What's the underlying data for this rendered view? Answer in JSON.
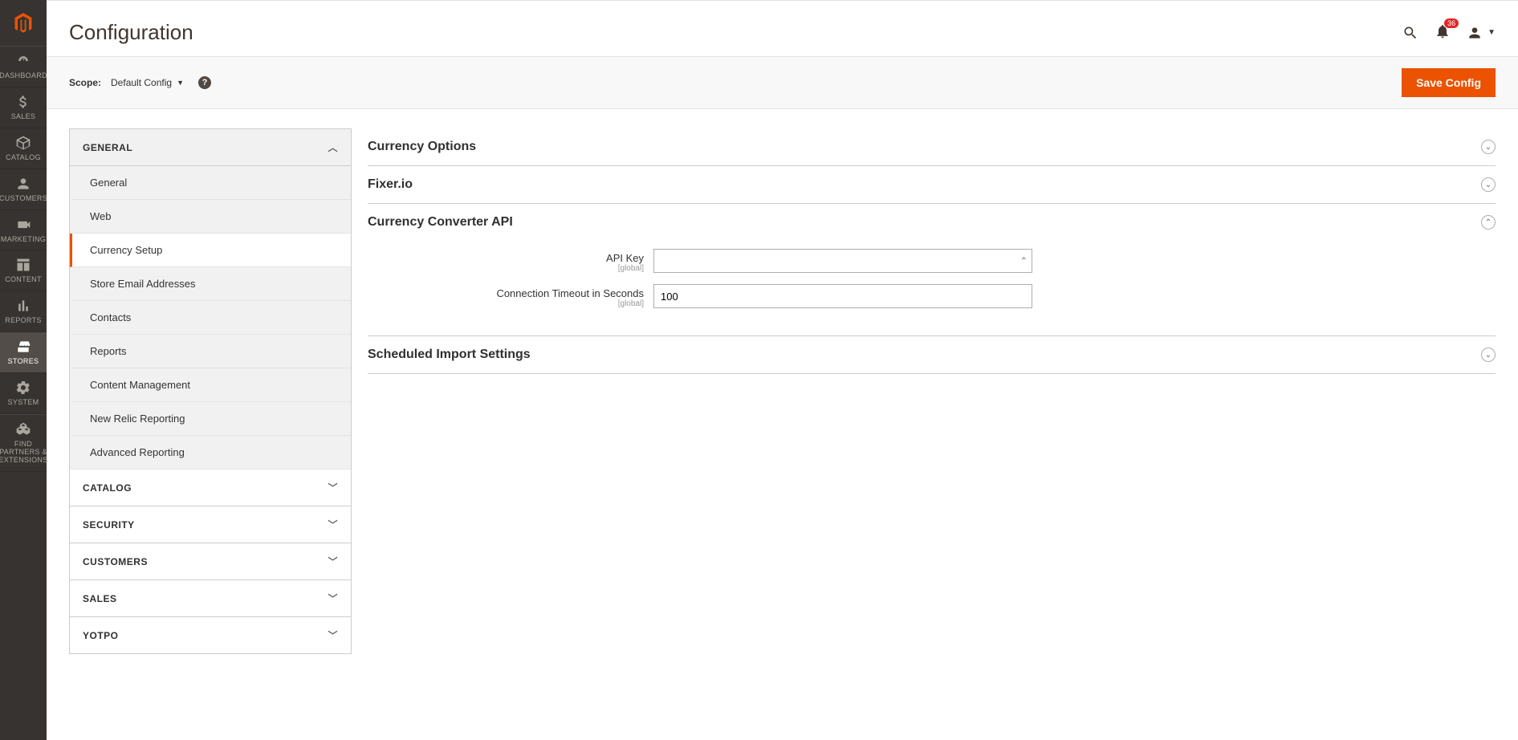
{
  "sidebar": {
    "items": [
      {
        "label": "DASHBOARD",
        "icon": "dashboard"
      },
      {
        "label": "SALES",
        "icon": "dollar"
      },
      {
        "label": "CATALOG",
        "icon": "box"
      },
      {
        "label": "CUSTOMERS",
        "icon": "person"
      },
      {
        "label": "MARKETING",
        "icon": "megaphone"
      },
      {
        "label": "CONTENT",
        "icon": "layout"
      },
      {
        "label": "REPORTS",
        "icon": "bars"
      },
      {
        "label": "STORES",
        "icon": "store",
        "active": true
      },
      {
        "label": "SYSTEM",
        "icon": "gear"
      },
      {
        "label": "FIND PARTNERS & EXTENSIONS",
        "icon": "cubes"
      }
    ]
  },
  "header": {
    "title": "Configuration",
    "notification_count": "36"
  },
  "scope": {
    "label": "Scope:",
    "value": "Default Config"
  },
  "actions": {
    "save": "Save Config"
  },
  "config_tabs": {
    "groups": [
      {
        "label": "GENERAL",
        "expanded": true,
        "items": [
          {
            "label": "General"
          },
          {
            "label": "Web"
          },
          {
            "label": "Currency Setup",
            "active": true
          },
          {
            "label": "Store Email Addresses"
          },
          {
            "label": "Contacts"
          },
          {
            "label": "Reports"
          },
          {
            "label": "Content Management"
          },
          {
            "label": "New Relic Reporting"
          },
          {
            "label": "Advanced Reporting"
          }
        ]
      },
      {
        "label": "CATALOG",
        "expanded": false
      },
      {
        "label": "SECURITY",
        "expanded": false
      },
      {
        "label": "CUSTOMERS",
        "expanded": false
      },
      {
        "label": "SALES",
        "expanded": false
      },
      {
        "label": "YOTPO",
        "expanded": false
      }
    ]
  },
  "sections": [
    {
      "title": "Currency Options",
      "expanded": false
    },
    {
      "title": "Fixer.io",
      "expanded": false
    },
    {
      "title": "Currency Converter API",
      "expanded": true,
      "fields": [
        {
          "label": "API Key",
          "scope": "[global]",
          "value": "",
          "revealable": true
        },
        {
          "label": "Connection Timeout in Seconds",
          "scope": "[global]",
          "value": "100"
        }
      ]
    },
    {
      "title": "Scheduled Import Settings",
      "expanded": false
    }
  ]
}
